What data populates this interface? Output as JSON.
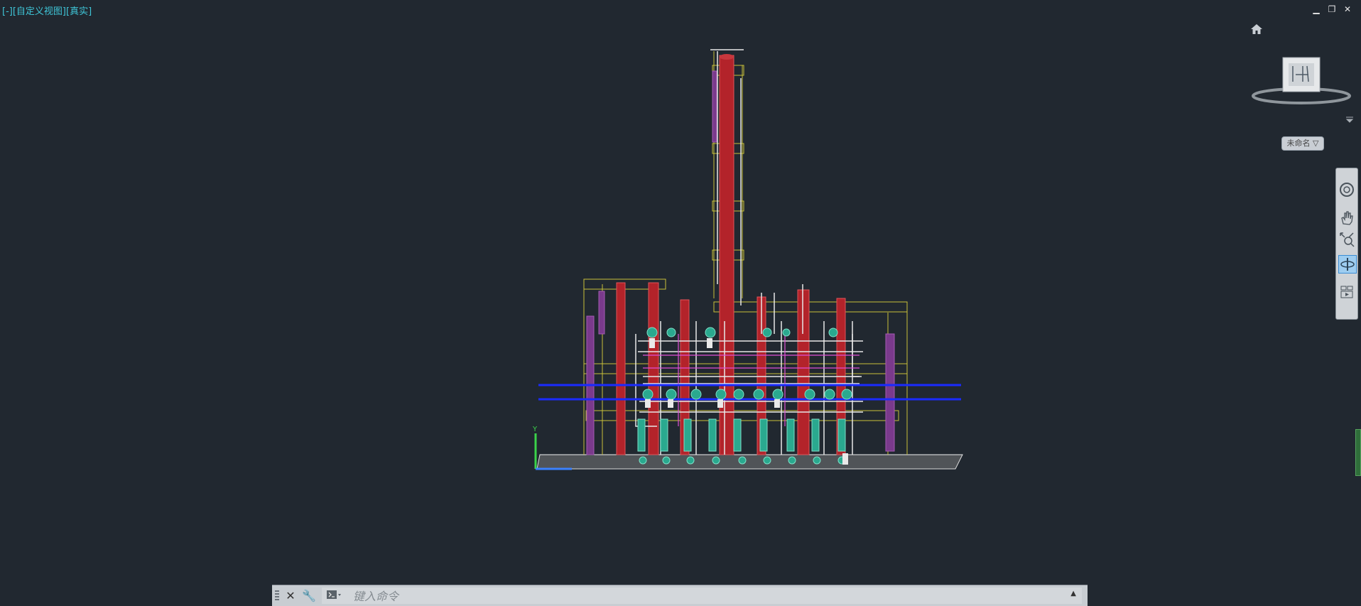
{
  "viewport": {
    "label_parts": [
      "[-]",
      "[自定义视图]",
      "[真实]"
    ]
  },
  "window_controls": {
    "minimize": "▁",
    "restore": "❐",
    "close": "✕"
  },
  "viewcube": {
    "ucs_label": "未命名 ▽"
  },
  "navbar": {
    "buttons": [
      "steeringwheel-icon",
      "pan-icon",
      "zoom-extents-icon",
      "orbit-icon",
      "showmotion-icon"
    ],
    "active": "orbit-icon"
  },
  "command_line": {
    "placeholder": "键入命令"
  },
  "colors": {
    "background": "#212830",
    "column": "#b3232a",
    "structure": "#c9c13a",
    "pipe": "#e8e8e8",
    "pump": "#2aa98f",
    "blue_line": "#1a2bff",
    "ladder": "#8a3b9a"
  },
  "icons": {
    "home": "home-icon",
    "viewcube": "viewcube-icon",
    "axis": "ucs-axis-icon"
  }
}
